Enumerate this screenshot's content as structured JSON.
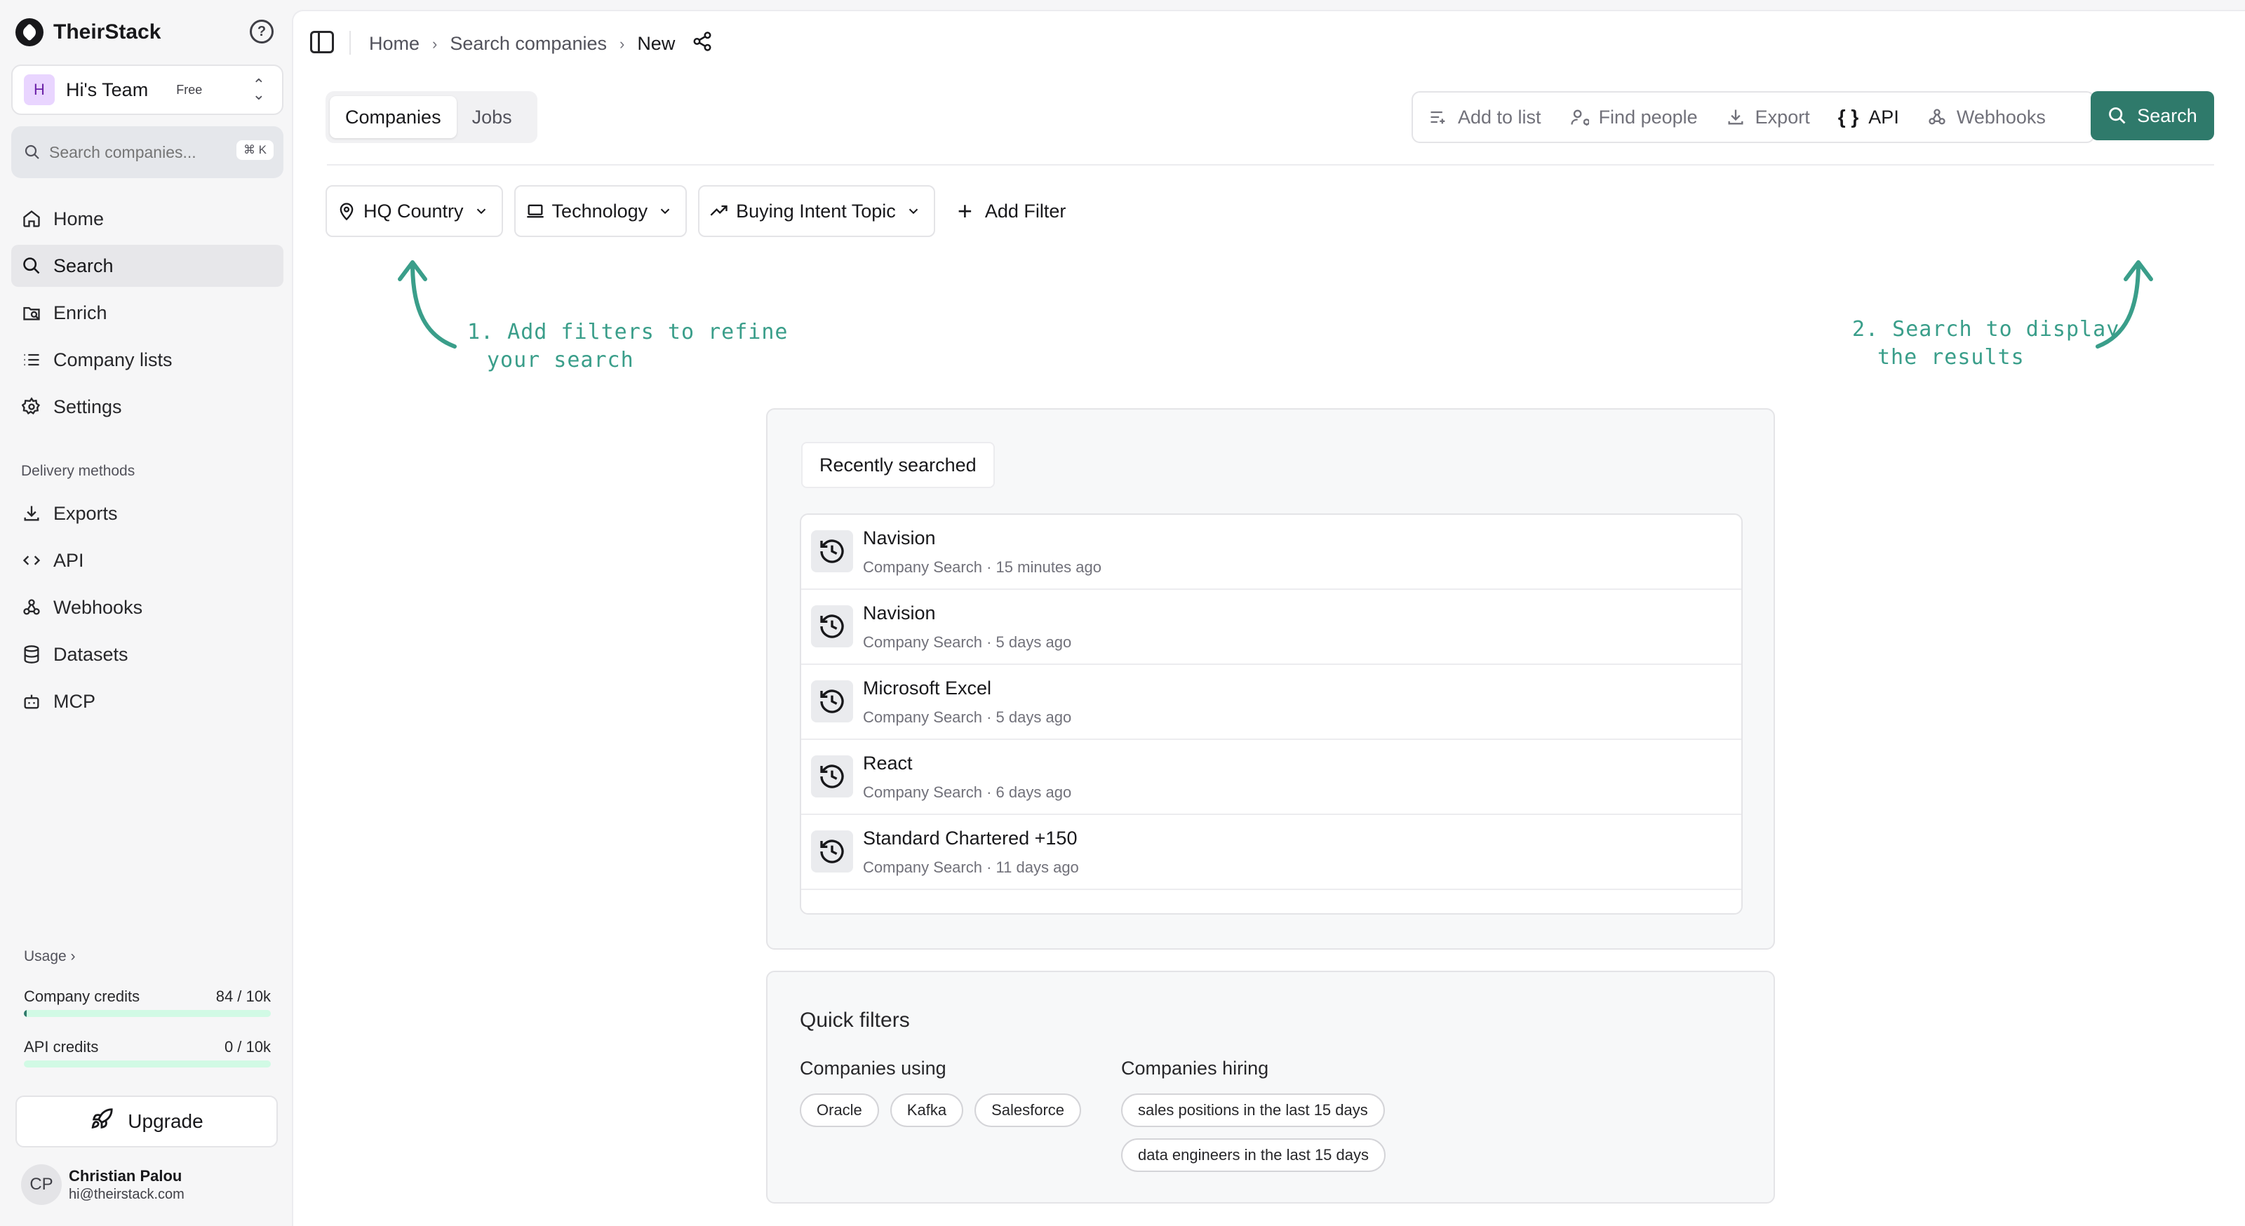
{
  "app": {
    "name": "TheirStack"
  },
  "team": {
    "avatar_letter": "H",
    "name": "Hi's Team",
    "plan": "Free"
  },
  "sidebar_search": {
    "placeholder": "Search companies...",
    "shortcut": "⌘ K"
  },
  "nav": {
    "primary": [
      {
        "label": "Home",
        "icon": "home-icon"
      },
      {
        "label": "Search",
        "icon": "search-icon",
        "active": true
      },
      {
        "label": "Enrich",
        "icon": "enrich-icon"
      },
      {
        "label": "Company lists",
        "icon": "list-icon"
      },
      {
        "label": "Settings",
        "icon": "gear-icon"
      }
    ],
    "section_title": "Delivery methods",
    "delivery": [
      {
        "label": "Exports",
        "icon": "download-icon"
      },
      {
        "label": "API",
        "icon": "code-icon"
      },
      {
        "label": "Webhooks",
        "icon": "webhook-icon"
      },
      {
        "label": "Datasets",
        "icon": "database-icon"
      },
      {
        "label": "MCP",
        "icon": "bot-icon"
      }
    ]
  },
  "usage": {
    "label": "Usage",
    "company_credits": {
      "label": "Company credits",
      "value": "84 / 10k",
      "fraction": 0.0084
    },
    "api_credits": {
      "label": "API credits",
      "value": "0 / 10k",
      "fraction": 0
    }
  },
  "upgrade": {
    "label": "Upgrade"
  },
  "user": {
    "initials": "CP",
    "name": "Christian Palou",
    "email": "hi@theirstack.com"
  },
  "breadcrumb": {
    "items": [
      "Home",
      "Search companies"
    ],
    "current": "New"
  },
  "tabs": [
    {
      "label": "Companies",
      "active": true
    },
    {
      "label": "Jobs"
    }
  ],
  "toolbar": {
    "add_to_list": "Add to list",
    "find_people": "Find people",
    "export": "Export",
    "api": "API",
    "webhooks": "Webhooks",
    "search": "Search"
  },
  "filters": {
    "hq_country": "HQ Country",
    "technology": "Technology",
    "buying_intent": "Buying Intent Topic",
    "add_filter": "Add Filter"
  },
  "hints": {
    "left": [
      "1. Add filters to refine",
      "your search"
    ],
    "right": [
      "2. Search to display",
      "the results"
    ]
  },
  "recent": {
    "title": "Recently searched",
    "items": [
      {
        "name": "Navision",
        "type": "Company Search",
        "time": "15 minutes ago"
      },
      {
        "name": "Navision",
        "type": "Company Search",
        "time": "5 days ago"
      },
      {
        "name": "Microsoft Excel",
        "type": "Company Search",
        "time": "5 days ago"
      },
      {
        "name": "React",
        "type": "Company Search",
        "time": "6 days ago"
      },
      {
        "name": "Standard Chartered +150",
        "type": "Company Search",
        "time": "11 days ago"
      }
    ]
  },
  "quick_filters": {
    "title": "Quick filters",
    "using": {
      "title": "Companies using",
      "chips": [
        "Oracle",
        "Kafka",
        "Salesforce"
      ]
    },
    "hiring": {
      "title": "Companies hiring",
      "chips": [
        "sales positions in the last 15 days",
        "data engineers in the last 15 days"
      ]
    }
  },
  "colors": {
    "brand": "#2f7a6b",
    "hint": "#3a9e8a",
    "sidebar_bg": "#f6f6f7"
  }
}
